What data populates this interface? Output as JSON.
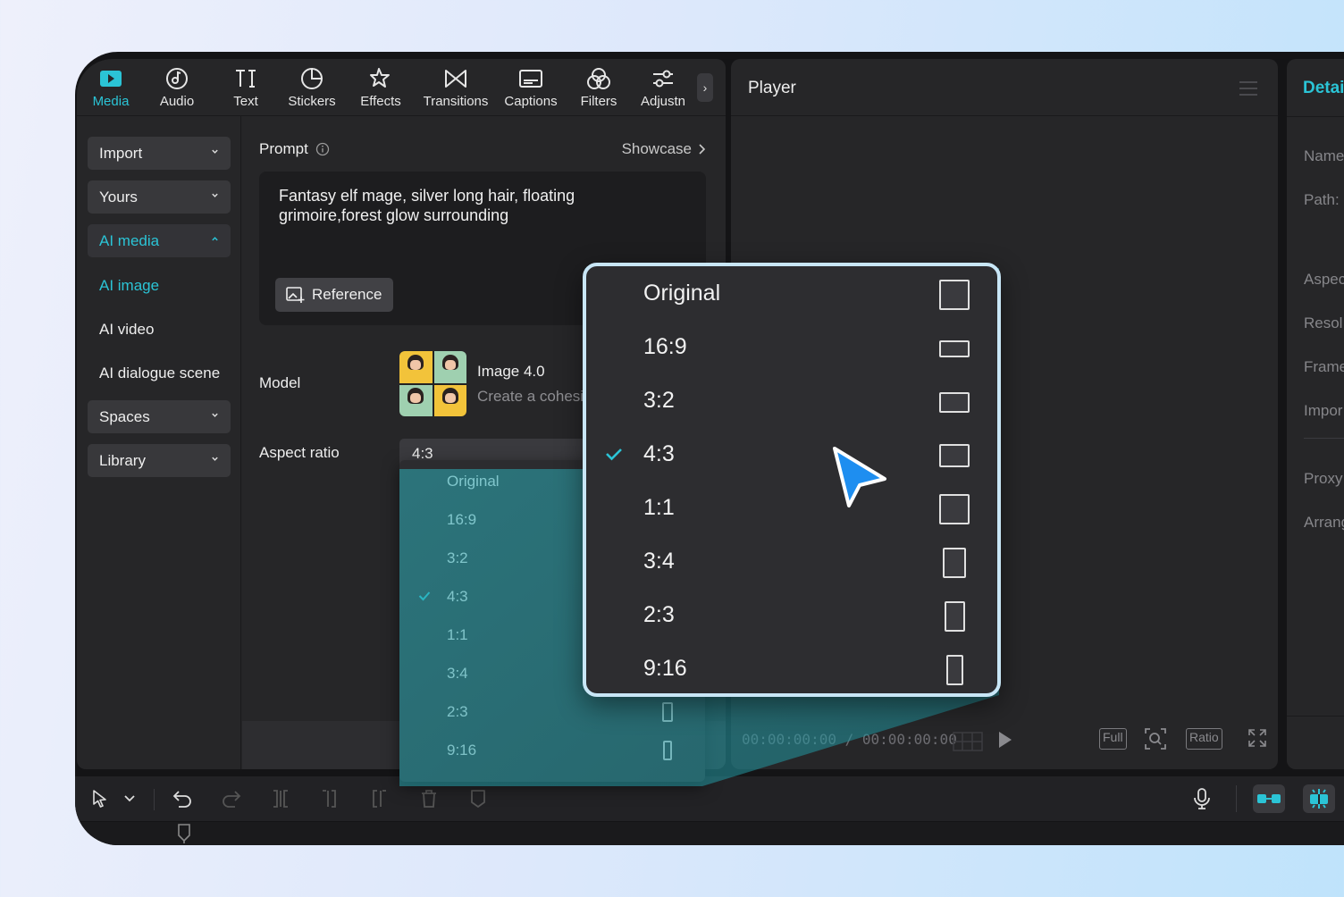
{
  "toolbar": {
    "items": [
      {
        "label": "Media",
        "icon": "media-icon",
        "active": true
      },
      {
        "label": "Audio",
        "icon": "audio-icon"
      },
      {
        "label": "Text",
        "icon": "text-icon"
      },
      {
        "label": "Stickers",
        "icon": "stickers-icon"
      },
      {
        "label": "Effects",
        "icon": "effects-icon"
      },
      {
        "label": "Transitions",
        "icon": "transitions-icon"
      },
      {
        "label": "Captions",
        "icon": "captions-icon"
      },
      {
        "label": "Filters",
        "icon": "filters-icon"
      },
      {
        "label": "Adjustn",
        "icon": "adjustment-icon"
      }
    ],
    "more_icon": "chevron-right-icon"
  },
  "sidebar": {
    "import": "Import",
    "yours": "Yours",
    "ai_media": "AI media",
    "ai_image": "AI image",
    "ai_video": "AI video",
    "ai_dialogue": "AI dialogue scene",
    "spaces": "Spaces",
    "library": "Library"
  },
  "content": {
    "prompt_label": "Prompt",
    "showcase": "Showcase",
    "prompt_text": "Fantasy elf mage, silver long hair, floating grimoire,forest glow surrounding",
    "reference": "Reference",
    "model_label": "Model",
    "model_name": "Image 4.0",
    "model_desc": "Create a cohesi",
    "aspect_label": "Aspect ratio",
    "aspect_value": "4:3"
  },
  "aspect_options": [
    "Original",
    "16:9",
    "3:2",
    "4:3",
    "1:1",
    "3:4",
    "2:3",
    "9:16"
  ],
  "aspect_selected": "4:3",
  "player": {
    "title": "Player",
    "timecode": "00:00:00:00 / 00:00:00:00",
    "full": "Full",
    "ratio": "Ratio"
  },
  "details": {
    "title": "Detai",
    "rows": [
      "Name",
      "Path:",
      "Aspec",
      "Resol",
      "Frame",
      "Impor",
      "Proxy",
      "Arrang"
    ]
  },
  "colors": {
    "accent": "#2bc4d6",
    "panel": "#262628",
    "callout_border": "#c8e6f6",
    "cursor": "#1e8ef0"
  }
}
